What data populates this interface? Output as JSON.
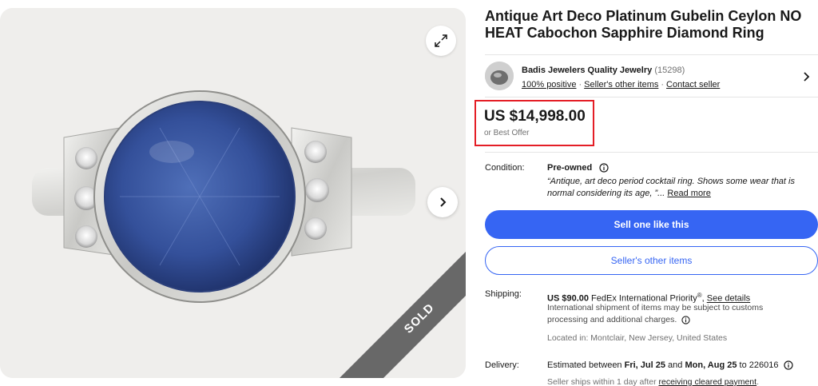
{
  "gallery": {
    "expand_icon": "expand-diagonal-arrows-icon",
    "next_icon": "chevron-right-icon",
    "sold_label": "SOLD"
  },
  "listing": {
    "title": "Antique Art Deco Platinum Gubelin Ceylon NO HEAT Cabochon Sapphire Diamond Ring"
  },
  "seller": {
    "name": "Badis Jewelers Quality Jewelry",
    "feedback_count": "(15298)",
    "positive_link": "100% positive",
    "other_items_link": "Seller's other items",
    "contact_link": "Contact seller",
    "separator": "·"
  },
  "price": {
    "amount": "US $14,998.00",
    "offer_note": "or Best Offer",
    "highlight_color": "#e41e26"
  },
  "condition": {
    "label": "Condition:",
    "value": "Pre-owned",
    "description": "“Antique, art deco period cocktail ring. Shows some wear that is normal considering its age, ”...",
    "read_more": "Read more"
  },
  "actions": {
    "primary": "Sell one like this",
    "secondary": "Seller's other items",
    "accent_color": "#3665f3"
  },
  "shipping": {
    "label": "Shipping:",
    "cost": "US $90.00",
    "service": "FedEx International Priority",
    "trademark": "®",
    "details_link": "See details",
    "note": "International shipment of items may be subject to customs processing and additional charges.",
    "location": "Located in: Montclair, New Jersey, United States"
  },
  "delivery": {
    "label": "Delivery:",
    "prefix": "Estimated between",
    "start": "Fri, Jul 25",
    "and": "and",
    "end": "Mon, Aug 25",
    "to": "to 226016",
    "handling_prefix": "Seller ships within 1 day after",
    "handling_link": "receiving cleared payment"
  }
}
